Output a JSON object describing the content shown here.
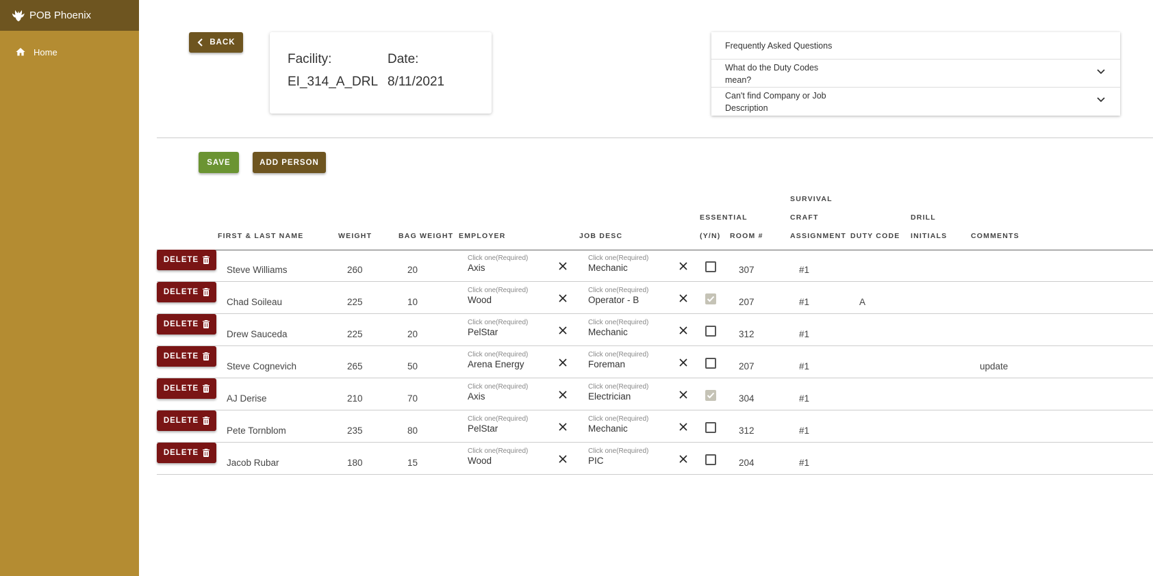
{
  "app": {
    "title": "POB Phoenix"
  },
  "sidebar": {
    "items": [
      {
        "label": "Home",
        "icon": "home-icon"
      }
    ]
  },
  "back_label": "Back",
  "facility": {
    "facility_label": "Facility:",
    "facility_value": "EI_314_A_DRL",
    "date_label": "Date:",
    "date_value": "8/11/2021"
  },
  "faq": {
    "title": "Frequently Asked Questions",
    "items": [
      {
        "question": "What do the Duty Codes mean?"
      },
      {
        "question": "Can't find Company or Job Description"
      }
    ]
  },
  "actions": {
    "save_label": "Save",
    "add_label": "Add Person"
  },
  "table": {
    "headers": {
      "name": "First & Last Name",
      "weight": "Weight",
      "bag_weight": "Bag Weight",
      "employer": "Employer",
      "job_desc": "Job Desc",
      "essential_1": "Essential",
      "essential_2": "(Y/N)",
      "room": "Room #",
      "survival_1": "Survival",
      "survival_2": "Craft",
      "survival_3": "Assignment",
      "duty": "Duty Code",
      "drill_1": "Drill",
      "drill_2": "Initials",
      "comments": "Comments"
    },
    "delete_label": "Delete",
    "select_placeholder": "Click one(Required)",
    "rows": [
      {
        "name": "Steve Williams",
        "weight": "260",
        "bag": "20",
        "employer": "Axis",
        "job": "Mechanic",
        "essential": false,
        "room": "307",
        "survival": "#1",
        "duty": "",
        "initials": "",
        "comments": ""
      },
      {
        "name": "Chad Soileau",
        "weight": "225",
        "bag": "10",
        "employer": "Wood",
        "job": "Operator - B",
        "essential": true,
        "room": "207",
        "survival": "#1",
        "duty": "A",
        "initials": "",
        "comments": ""
      },
      {
        "name": "Drew Sauceda",
        "weight": "225",
        "bag": "20",
        "employer": "PelStar",
        "job": "Mechanic",
        "essential": false,
        "room": "312",
        "survival": "#1",
        "duty": "",
        "initials": "",
        "comments": ""
      },
      {
        "name": "Steve Cognevich",
        "weight": "265",
        "bag": "50",
        "employer": "Arena Energy",
        "job": "Foreman",
        "essential": false,
        "room": "207",
        "survival": "#1",
        "duty": "",
        "initials": "",
        "comments": "update"
      },
      {
        "name": "AJ Derise",
        "weight": "210",
        "bag": "70",
        "employer": "Axis",
        "job": "Electrician",
        "essential": true,
        "room": "304",
        "survival": "#1",
        "duty": "",
        "initials": "",
        "comments": ""
      },
      {
        "name": "Pete Tornblom",
        "weight": "235",
        "bag": "80",
        "employer": "PelStar",
        "job": "Mechanic",
        "essential": false,
        "room": "312",
        "survival": "#1",
        "duty": "",
        "initials": "",
        "comments": ""
      },
      {
        "name": "Jacob Rubar",
        "weight": "180",
        "bag": "15",
        "employer": "Wood",
        "job": "PIC",
        "essential": false,
        "room": "204",
        "survival": "#1",
        "duty": "",
        "initials": "",
        "comments": ""
      }
    ]
  },
  "colors": {
    "sidebar": "#b48c32",
    "header": "#6e5520",
    "save": "#6b9432",
    "delete": "#7a1515"
  }
}
